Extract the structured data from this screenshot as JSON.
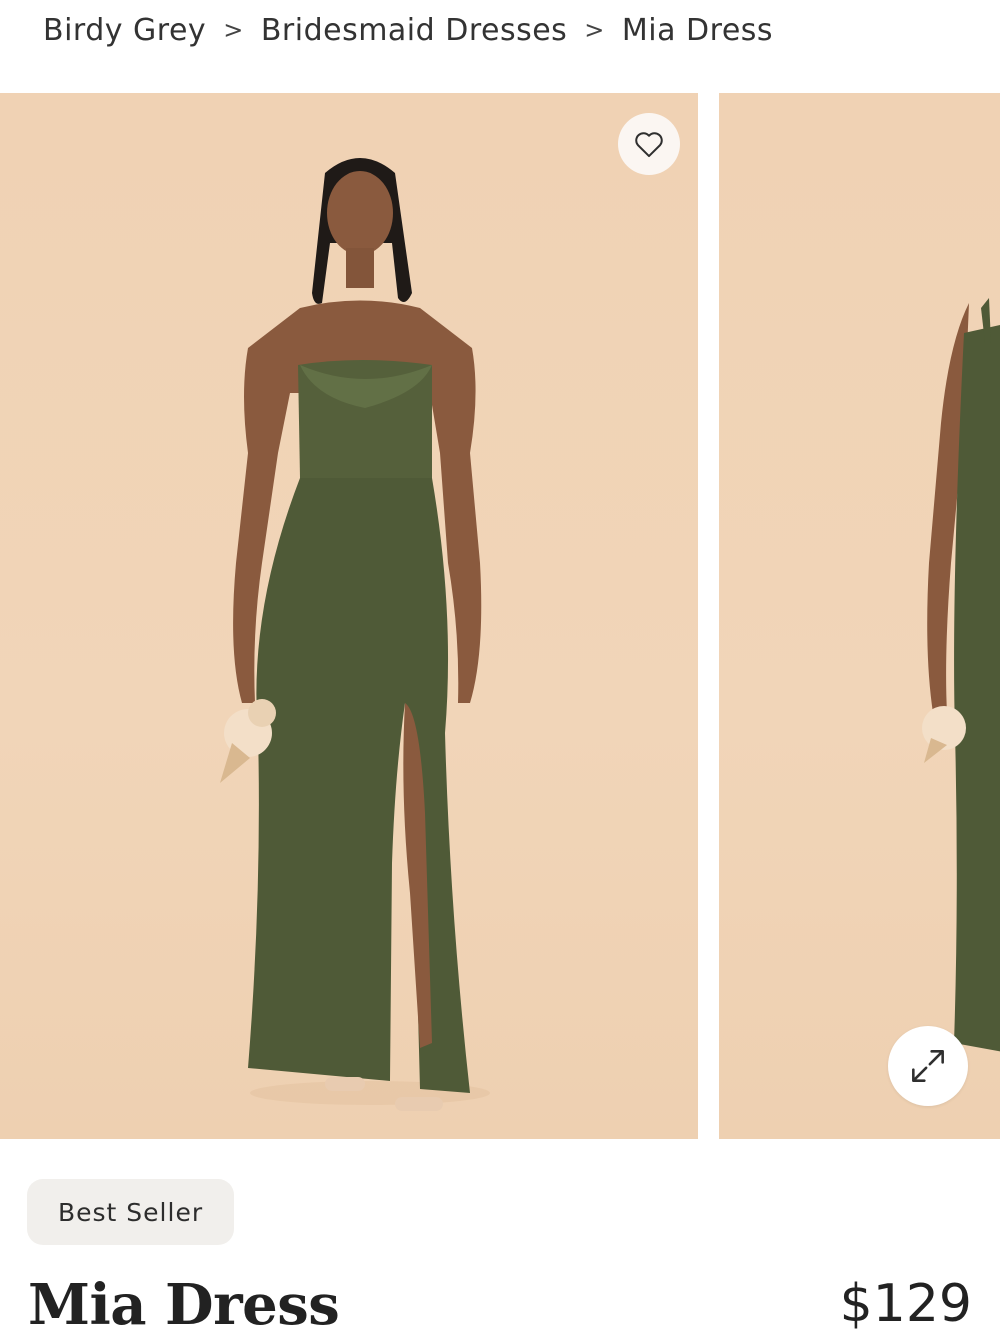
{
  "breadcrumb": {
    "items": [
      "Birdy Grey",
      "Bridesmaid Dresses",
      "Mia Dress"
    ],
    "separator": ">"
  },
  "gallery": {
    "favorite_icon": "heart-icon",
    "zoom_icon": "expand-arrows-icon",
    "background_color": "#f0d2b4",
    "dress_color": "#4f5a37"
  },
  "product": {
    "badge": "Best Seller",
    "name": "Mia Dress",
    "price": "$129"
  }
}
